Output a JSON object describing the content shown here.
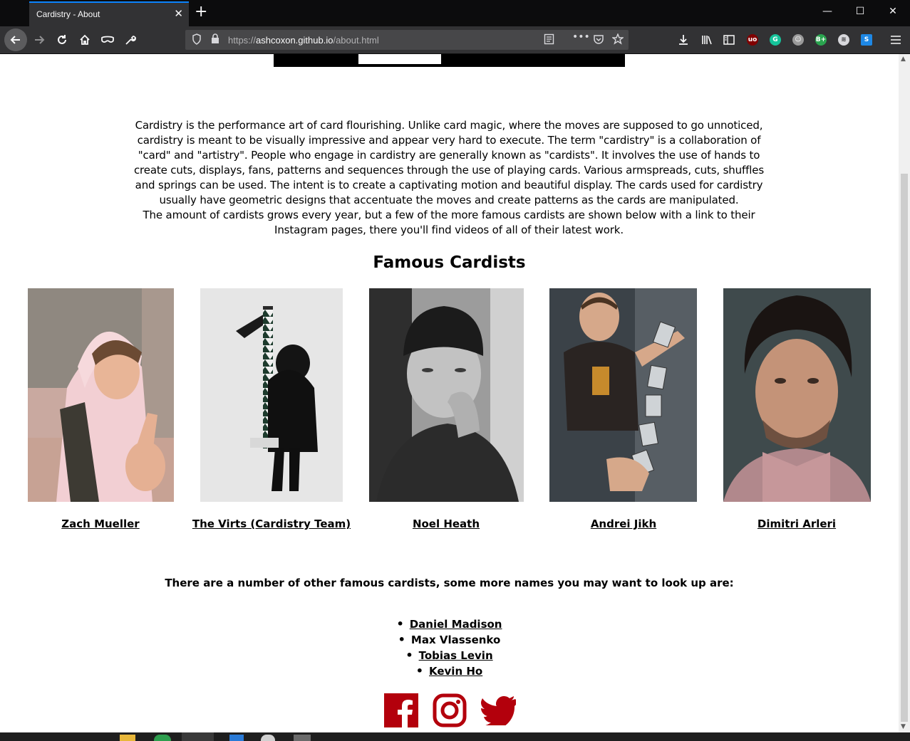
{
  "browser": {
    "tab_title": "Cardistry - About",
    "tab_close": "✕",
    "new_tab": "+",
    "window_controls": [
      "—",
      "☐",
      "✕"
    ],
    "url_scheme": "https://",
    "url_host": "ashcoxon.github.io",
    "url_path": "/about.html",
    "page_actions": "•••"
  },
  "page": {
    "intro": [
      "Cardistry is the performance art of card flourishing. Unlike card magic, where the moves are supposed to go unnoticed, cardistry is meant to be visually impressive and appear very hard to execute. The term \"cardistry\" is a collaboration of \"card\" and \"artistry\". People who engage in cardistry are generally known as \"cardists\". It involves the use of hands to create cuts, displays, fans, patterns and sequences through the use of playing cards. Various armspreads, cuts, shuffles and springs can be used. The intent is to create a captivating motion and beautiful display. The cards used for cardistry usually have geometric designs that accentuate the moves and create patterns as the cards are manipulated.",
      "The amount of cardists grows every year, but a few of the more famous cardists are shown below with a link to their Instagram pages, there you'll find videos of all of their latest work."
    ],
    "famous_title": "Famous Cardists",
    "cardists": [
      {
        "name": "Zach Mueller"
      },
      {
        "name": "The Virts (Cardistry Team)"
      },
      {
        "name": "Noel Heath"
      },
      {
        "name": "Andrei Jikh"
      },
      {
        "name": "Dimitri Arleri"
      }
    ],
    "more_text": "There are a number of other famous cardists, some more names you may want to look up are:",
    "more_names": [
      {
        "name": "Daniel Madison",
        "link": true
      },
      {
        "name": "Max Vlassenko",
        "link": false
      },
      {
        "name": "Tobias Levin",
        "link": true
      },
      {
        "name": "Kevin Ho",
        "link": true
      }
    ],
    "social_icons": [
      "facebook-icon",
      "instagram-icon",
      "twitter-icon"
    ],
    "social_color": "#b3000c"
  },
  "colors": {
    "accent": "#0a84ff",
    "toolbar": "#323234",
    "tabstrip": "#0c0c0d"
  }
}
